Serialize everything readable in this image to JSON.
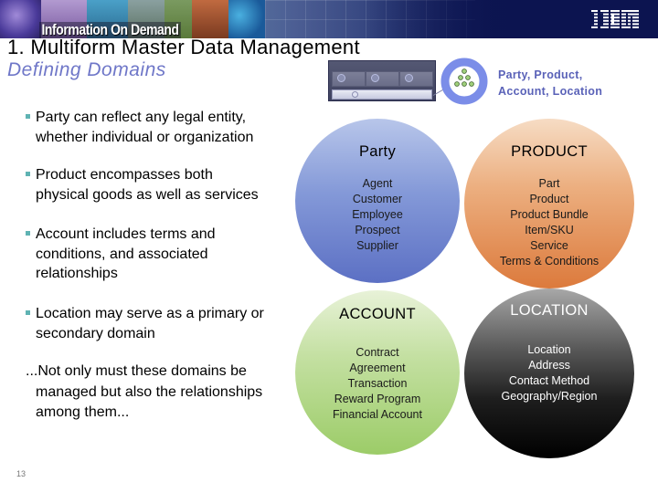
{
  "banner": {
    "brand_text": "Information On Demand",
    "logo": "IBM"
  },
  "slide": {
    "title": "1. Multiform Master Data Management",
    "subtitle": "Defining Domains",
    "page_number": "13"
  },
  "legend": {
    "icon": "panel-and-domain-ring-icon",
    "label_line1": "Party, Product,",
    "label_line2": "Account, Location"
  },
  "bullets": [
    {
      "lines": [
        "Party can reflect any legal entity,",
        "whether individual or organization"
      ]
    },
    {
      "lines": [
        "Product encompasses both",
        "physical goods as well as services"
      ]
    },
    {
      "lines": [
        "Account includes terms and",
        "conditions, and associated",
        "relationships"
      ]
    },
    {
      "lines": [
        "Location may serve as a primary or",
        "secondary domain"
      ]
    }
  ],
  "closing": {
    "line1": "...Not only must these domains be",
    "line2": "managed but also the relationships",
    "line3": "among them..."
  },
  "domains": [
    {
      "name": "Party",
      "color": "#6f83cc",
      "items": [
        "Agent",
        "Customer",
        "Employee",
        "Prospect",
        "Supplier"
      ]
    },
    {
      "name": "PRODUCT",
      "color": "#e49560",
      "items": [
        "Part",
        "Product",
        "Product Bundle",
        "Item/SKU",
        "Service",
        "Terms & Conditions"
      ]
    },
    {
      "name": "ACCOUNT",
      "color": "#b2d688",
      "items": [
        "Contract",
        "Agreement",
        "Transaction",
        "Reward Program",
        "Financial Account"
      ]
    },
    {
      "name": "LOCATION",
      "color": "#2a2a2a",
      "items": [
        "Location",
        "Address",
        "Contact Method",
        "Geography/Region"
      ]
    }
  ]
}
